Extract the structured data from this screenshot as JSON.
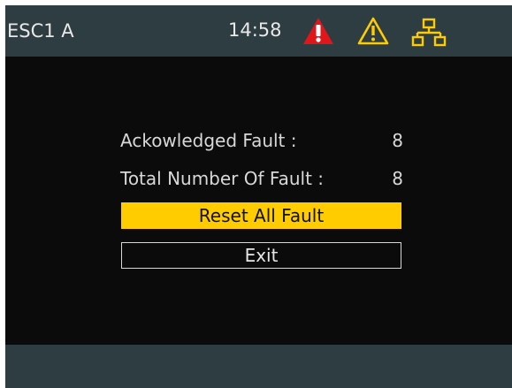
{
  "header": {
    "device_name": "ESC1 A",
    "time": "14:58",
    "icons": [
      "alarm-icon",
      "warning-icon",
      "network-icon"
    ]
  },
  "faults": {
    "acknowledged_label": "Ackowledged Fault :",
    "acknowledged_value": "8",
    "total_label": "Total Number Of Fault :",
    "total_value": "8"
  },
  "buttons": {
    "reset_label": "Reset All Fault",
    "exit_label": "Exit"
  },
  "colors": {
    "header_bg": "#2e3d42",
    "screen_bg": "#0b0b0b",
    "alarm_red": "#e0161b",
    "warning_yellow": "#ffcc00",
    "selected_button": "#ffcc00"
  }
}
